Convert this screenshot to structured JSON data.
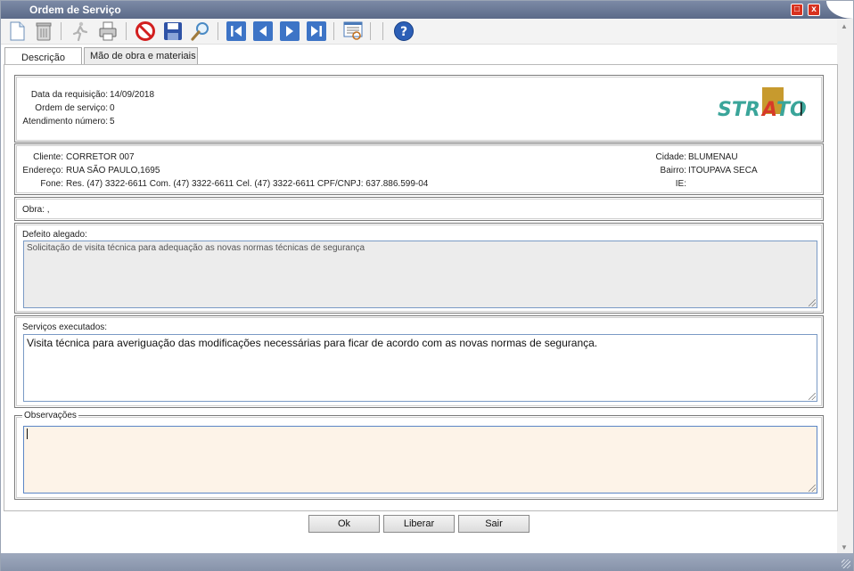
{
  "window": {
    "title": "Ordem de Serviço",
    "maximize_glyph": "□",
    "close_glyph": "x"
  },
  "toolbar": {
    "icons": [
      "new-document-icon",
      "trash-icon",
      "run-icon",
      "printer-icon",
      "cancel-icon",
      "save-icon",
      "search-icon",
      "first-record-icon",
      "previous-record-icon",
      "next-record-icon",
      "last-record-icon",
      "report-icon",
      "help-icon"
    ]
  },
  "tabs": [
    {
      "label": "Descrição"
    },
    {
      "label": "Mão de obra e materiais"
    }
  ],
  "header": {
    "requisicao_label": "Data da requisição:",
    "requisicao_value": "14/09/2018",
    "ordem_label": "Ordem de serviço:",
    "ordem_value": "0",
    "atendimento_label": "Atendimento número:",
    "atendimento_value": "5",
    "logo_text": "STRATO"
  },
  "client": {
    "cliente_label": "Cliente:",
    "cliente_value": "CORRETOR 007",
    "endereco_label": "Endereço:",
    "endereco_value": "RUA SÃO PAULO,1695",
    "fone_label": "Fone:",
    "fone_value": "Res. (47) 3322-6611 Com. (47) 3322-6611 Cel. (47) 3322-6611 CPF/CNPJ: 637.886.599-04",
    "cidade_label": "Cidade:",
    "cidade_value": "BLUMENAU",
    "bairro_label": "Bairro:",
    "bairro_value": "ITOUPAVA SECA",
    "ie_label": "IE:",
    "ie_value": ""
  },
  "obra": {
    "label": "Obra: ,"
  },
  "defeito": {
    "label": "Defeito alegado:",
    "value": "Solicitação de visita técnica para adequação as novas normas técnicas de segurança"
  },
  "servicos": {
    "label": "Serviços executados:",
    "value": "Visita técnica para averiguação das modificações necessárias para ficar de acordo com as novas normas de segurança."
  },
  "observacoes": {
    "label": "Observações",
    "value": ""
  },
  "buttons": {
    "ok": "Ok",
    "liberar": "Liberar",
    "sair": "Sair"
  },
  "colors": {
    "accent": "#5b6a88",
    "obs_bg": "#fdf3e8",
    "defeito_bg": "#ececec"
  }
}
